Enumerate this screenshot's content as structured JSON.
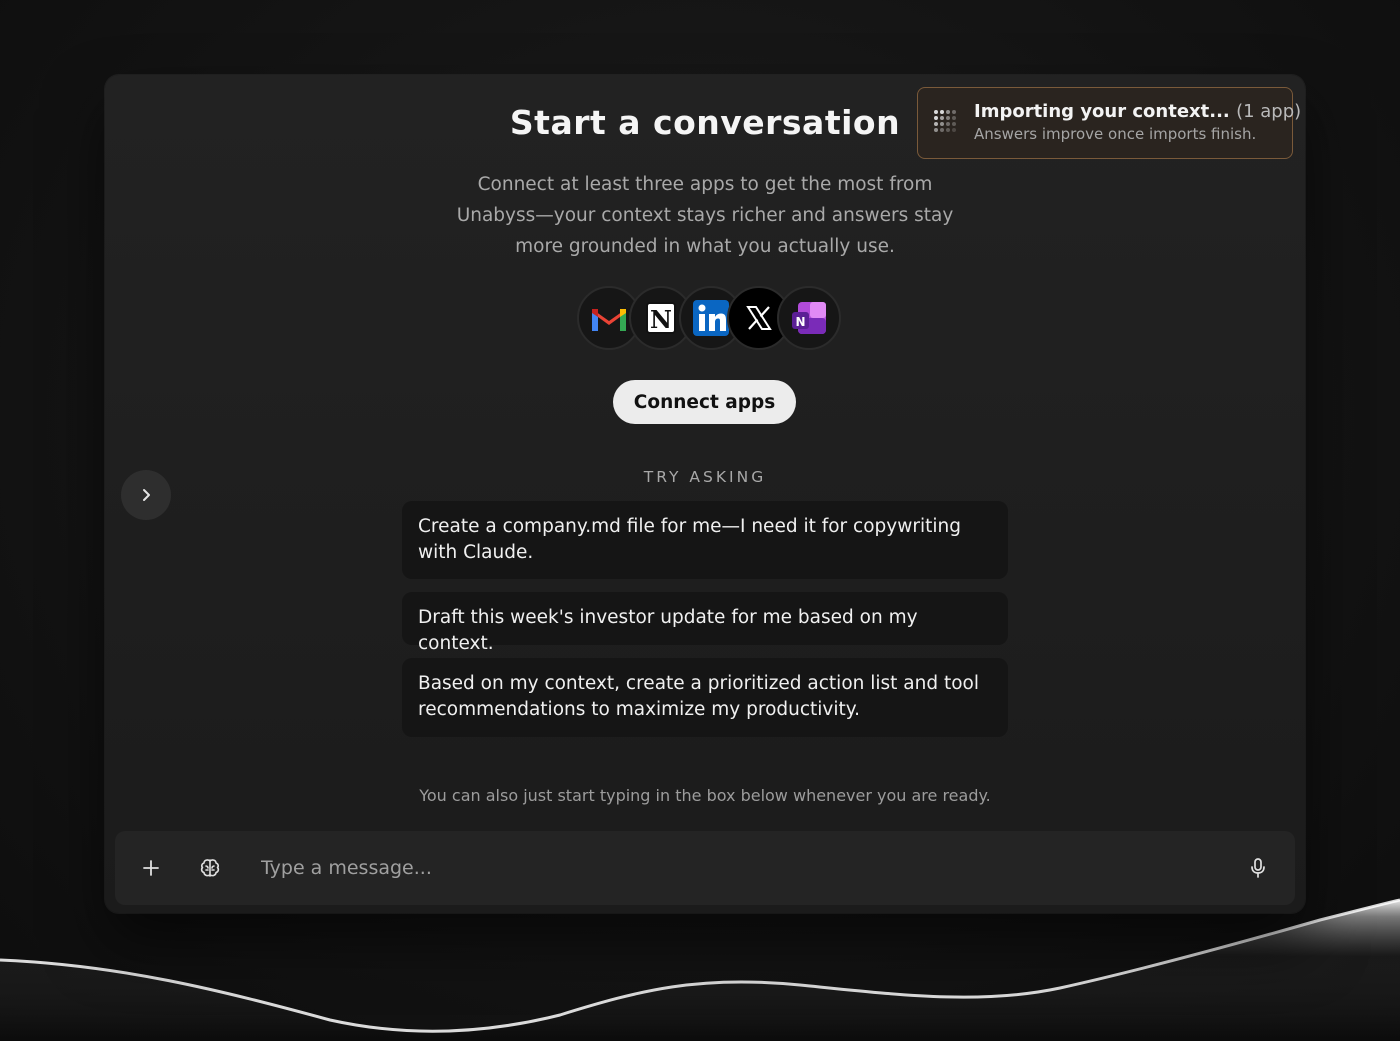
{
  "main": {
    "title": "Start a conversation",
    "subtitle": "Connect at least three apps to get the most from Unabyss—your context stays richer and answers stay more grounded in what you actually use.",
    "connect_label": "Connect apps",
    "try_asking_label": "TRY ASKING",
    "suggestions": [
      "Create a company.md file for me—I need it for copywriting with Claude.",
      "Draft this week's investor update for me based on my context.",
      "Based on my context, create a prioritized action list and tool recommendations to maximize my productivity."
    ],
    "hint": "You can also just start typing in the box below whenever you are ready."
  },
  "toast": {
    "title": "Importing your context...",
    "count": "(1 app)",
    "subtitle": "Answers improve once imports finish."
  },
  "apps": [
    {
      "name": "gmail-icon"
    },
    {
      "name": "notion-icon"
    },
    {
      "name": "linkedin-icon"
    },
    {
      "name": "x-icon"
    },
    {
      "name": "onenote-icon"
    }
  ],
  "composer": {
    "placeholder": "Type a message..."
  },
  "colors": {
    "background": "#121212",
    "panel": "#1f1f1f",
    "toast_border": "#7a5a3a",
    "button": "#ececec"
  }
}
